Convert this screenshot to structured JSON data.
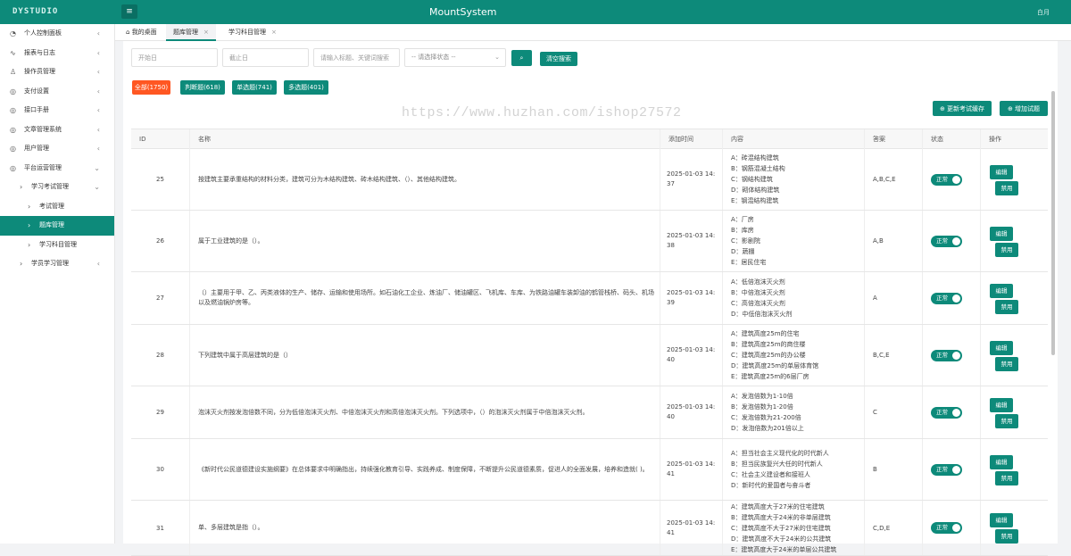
{
  "app": {
    "logo": "DYSTUDIO",
    "title": "MountSystem",
    "user": "白月"
  },
  "sidebar": {
    "items": [
      {
        "label": "个人控制面板",
        "icon": "dashboard-icon",
        "level": 1,
        "arrow": "‹",
        "active": false
      },
      {
        "label": "报表与日志",
        "icon": "pulse-icon",
        "level": 1,
        "arrow": "‹",
        "active": false
      },
      {
        "label": "操作员管理",
        "icon": "user-icon",
        "level": 1,
        "arrow": "‹",
        "active": false
      },
      {
        "label": "支付设置",
        "icon": "settings-icon",
        "level": 1,
        "arrow": "‹",
        "active": false
      },
      {
        "label": "接口手册",
        "icon": "settings-icon",
        "level": 1,
        "arrow": "‹",
        "active": false
      },
      {
        "label": "文章管理系统",
        "icon": "settings-icon",
        "level": 1,
        "arrow": "‹",
        "active": false
      },
      {
        "label": "用户管理",
        "icon": "settings-icon",
        "level": 1,
        "arrow": "‹",
        "active": false
      },
      {
        "label": "平台运营管理",
        "icon": "settings-icon",
        "level": 1,
        "arrow": "⌄",
        "active": false
      },
      {
        "label": "学习考试管理",
        "icon": "chevron-right-icon",
        "level": 2,
        "arrow": "⌄",
        "active": false
      },
      {
        "label": "考试管理",
        "icon": "chevron-right-icon",
        "level": 3,
        "arrow": "",
        "active": false
      },
      {
        "label": "题库管理",
        "icon": "chevron-right-icon",
        "level": 3,
        "arrow": "",
        "active": true
      },
      {
        "label": "学习科目管理",
        "icon": "chevron-right-icon",
        "level": 3,
        "arrow": "",
        "active": false
      },
      {
        "label": "学员学习管理",
        "icon": "chevron-right-icon",
        "level": 2,
        "arrow": "‹",
        "active": false
      }
    ]
  },
  "tabs": [
    {
      "label": "我的桌面",
      "icon": "home-icon",
      "closable": false,
      "active": false
    },
    {
      "label": "题库管理",
      "closable": true,
      "active": true
    },
    {
      "label": "学习科目管理",
      "closable": true,
      "active": false
    }
  ],
  "filter": {
    "start_placeholder": "开始日",
    "end_placeholder": "截止日",
    "keyword_placeholder": "请输入标题、关键词搜索",
    "status_select": "-- 请选择状态 --",
    "clear_label": "清空搜索"
  },
  "categories": [
    {
      "label": "全部(1750)",
      "active": true
    },
    {
      "label": "判断题(618)",
      "active": false
    },
    {
      "label": "单选题(741)",
      "active": false
    },
    {
      "label": "多选题(401)",
      "active": false
    }
  ],
  "watermark": "https://www.huzhan.com/ishop27572",
  "actions": {
    "update_cache": "更新考试缓存",
    "add_question": "增加试题"
  },
  "table": {
    "headers": [
      "ID",
      "名称",
      "添加时间",
      "内容",
      "答案",
      "状态",
      "操作"
    ],
    "edit_label": "编辑",
    "disable_label": "禁用",
    "rows": [
      {
        "id": "25",
        "name": "按建筑主要承重结构的材料分类，建筑可分为木结构建筑、砖木结构建筑、（）、其他结构建筑。",
        "time": "2025-01-03 14:37",
        "options": [
          "A：砖混结构建筑",
          "B：钢筋混凝土结构",
          "C：钢结构建筑",
          "D：砌体结构建筑",
          "E：钢混结构建筑"
        ],
        "answer": "A,B,C,E",
        "status": "正常"
      },
      {
        "id": "26",
        "name": "属于工业建筑的是（）。",
        "time": "2025-01-03 14:38",
        "options": [
          "A：厂房",
          "B：库房",
          "C：影剧院",
          "D：蔬棚",
          "E：居民住宅"
        ],
        "answer": "A,B",
        "status": "正常"
      },
      {
        "id": "27",
        "name": "（）主要用于甲、乙、丙类液体的生产、储存、运输和使用场所。如石油化工企业、炼油厂、储油罐区、飞机库、车库、为铁路油罐车装卸油的鹤管栈桥、码头、机场以及燃油锅炉房等。",
        "time": "2025-01-03 14:39",
        "options": [
          "A：低倍泡沫灭火剂",
          "B：中倍泡沫灭火剂",
          "C：高倍泡沫灭火剂",
          "D：中低倍泡沫灭火剂"
        ],
        "answer": "A",
        "status": "正常"
      },
      {
        "id": "28",
        "name": "下列建筑中属于高层建筑的是（）",
        "time": "2025-01-03 14:40",
        "options": [
          "A：建筑高度25m的住宅",
          "B：建筑高度25m的商住楼",
          "C：建筑高度25m的办公楼",
          "D：建筑高度25m的单层体育馆",
          "E：建筑高度25m的6层厂房"
        ],
        "answer": "B,C,E",
        "status": "正常"
      },
      {
        "id": "29",
        "name": "泡沫灭火剂按发泡倍数不同，分为低倍泡沫灭火剂、中倍泡沫灭火剂和高倍泡沫灭火剂。下列选项中，（）的泡沫灭火剂属于中倍泡沫灭火剂。",
        "time": "2025-01-03 14:40",
        "options": [
          "A：发泡倍数为1-10倍",
          "B：发泡倍数为1-20倍",
          "C：发泡倍数为21-200倍",
          "D：发泡倍数为201倍以上"
        ],
        "answer": "C",
        "status": "正常"
      },
      {
        "id": "30",
        "name": "《新时代公民道德建设实施纲要》在总体要求中明确指出，持续强化教育引导、实践养成、制度保障，不断提升公民道德素质，促进人的全面发展，培养和造就(          )。",
        "time": "2025-01-03 14:41",
        "options": [
          "A：担当社会主义现代化的时代新人",
          "B：担当民族复兴大任的时代新人",
          "C：社会主义建设者和接班人",
          "D：新时代的爱国者与奋斗者"
        ],
        "answer": "B",
        "status": "正常"
      },
      {
        "id": "31",
        "name": "单、多层建筑是指（）。",
        "time": "2025-01-03 14:41",
        "options": [
          "A：建筑高度大于27米的住宅建筑",
          "B：建筑高度大于24米的非单层建筑",
          "C：建筑高度不大于27米的住宅建筑",
          "D：建筑高度不大于24米的公共建筑",
          "E：建筑高度大于24米的单层公共建筑"
        ],
        "answer": "C,D,E",
        "status": "正常"
      }
    ]
  }
}
